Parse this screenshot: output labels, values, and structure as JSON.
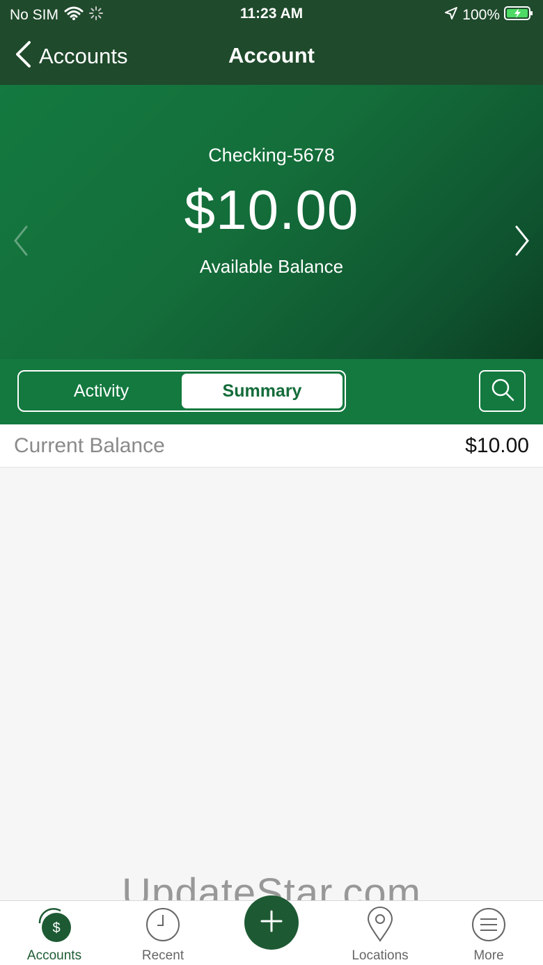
{
  "status_bar": {
    "carrier": "No SIM",
    "time": "11:23 AM",
    "battery": "100%",
    "icons": [
      "wifi-icon",
      "activity-spinner-icon",
      "location-arrow-icon",
      "battery-charging-icon"
    ]
  },
  "nav": {
    "back_label": "Accounts",
    "title": "Account",
    "back_icon": "chevron-left-icon"
  },
  "account": {
    "name": "Checking-5678",
    "balance": "$10.00",
    "balance_label": "Available Balance"
  },
  "tabs": {
    "activity": "Activity",
    "summary": "Summary",
    "selected": "Summary"
  },
  "summary": {
    "rows": [
      {
        "label": "Current Balance",
        "value": "$10.00"
      }
    ]
  },
  "watermark": "UpdateStar.com",
  "bottom_nav": {
    "items": [
      {
        "label": "Accounts",
        "icon": "accounts-dollar-icon",
        "active": true
      },
      {
        "label": "Recent",
        "icon": "clock-icon",
        "active": false
      },
      {
        "label": "",
        "icon": "plus-icon",
        "active": false
      },
      {
        "label": "Locations",
        "icon": "map-pin-icon",
        "active": false
      },
      {
        "label": "More",
        "icon": "menu-icon",
        "active": false
      }
    ]
  },
  "colors": {
    "header": "#1f4a2c",
    "brand_green": "#13793f",
    "dark_green": "#1d5a33",
    "background": "#f6f6f6"
  }
}
